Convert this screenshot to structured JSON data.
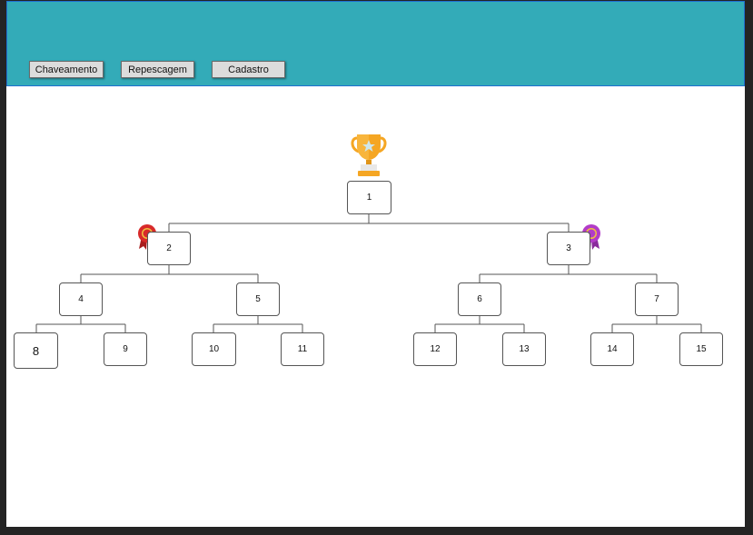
{
  "nav": {
    "buttons": [
      "Chaveamento",
      "Repescagem",
      "Cadastro"
    ]
  },
  "bracket": {
    "nodes": [
      "1",
      "2",
      "3",
      "4",
      "5",
      "6",
      "7",
      "8",
      "9",
      "10",
      "11",
      "12",
      "13",
      "14",
      "15"
    ]
  },
  "icons": {
    "champion": "trophy-icon",
    "left_semifinal": "ribbon-medal-icon",
    "right_semifinal": "ribbon-medal-icon"
  },
  "colors": {
    "header": "#33abb8",
    "trophy": "#f5a623",
    "left_ribbon": "#d82a2a",
    "right_ribbon": "#b23cc8"
  }
}
